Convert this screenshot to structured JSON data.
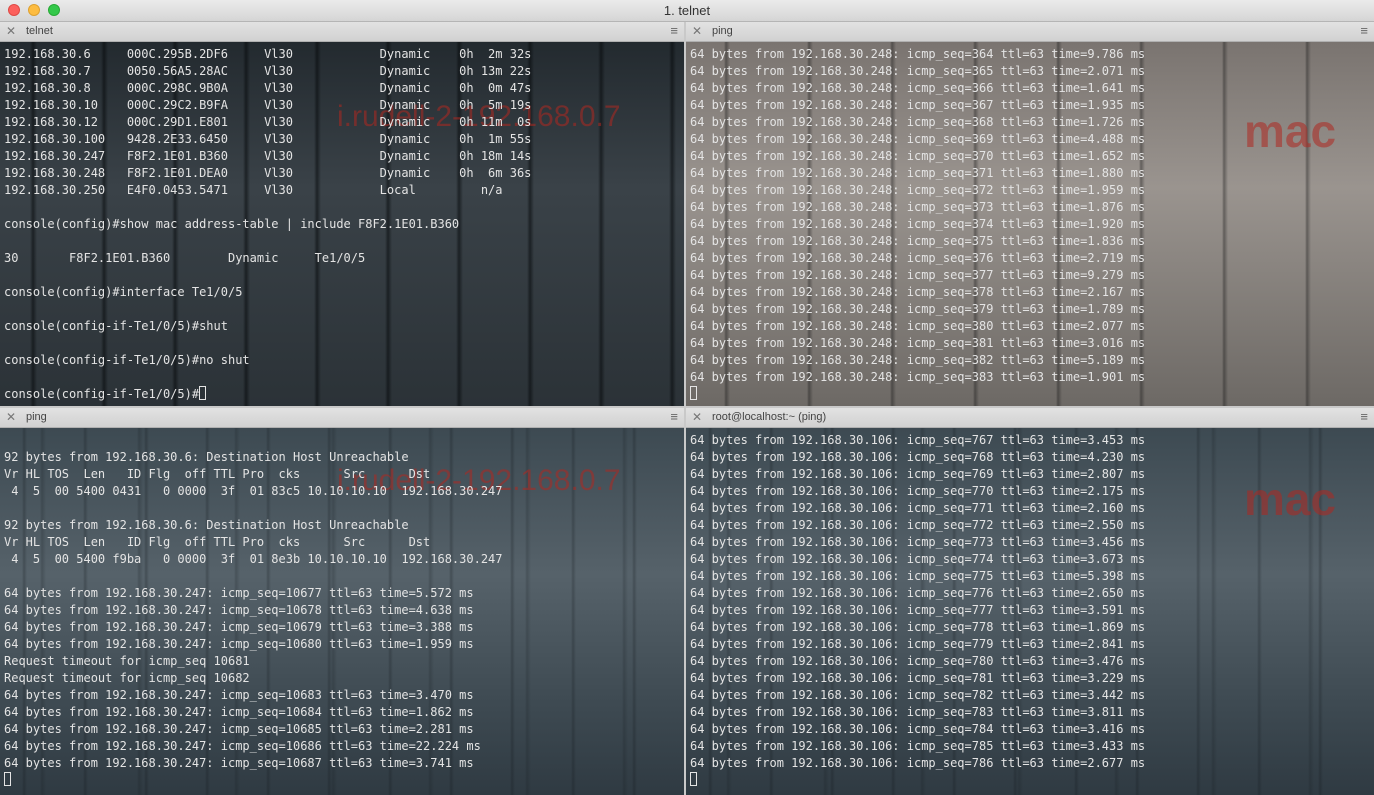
{
  "window": {
    "title": "1. telnet"
  },
  "panes": {
    "top_left": {
      "tab": "telnet",
      "watermark": "i.rudell-2-192.168.0.7",
      "lines": [
        "192.168.30.6     000C.295B.2DF6     Vl30            Dynamic    0h  2m 32s",
        "192.168.30.7     0050.56A5.28AC     Vl30            Dynamic    0h 13m 22s",
        "192.168.30.8     000C.298C.9B0A     Vl30            Dynamic    0h  0m 47s",
        "192.168.30.10    000C.29C2.B9FA     Vl30            Dynamic    0h  5m 19s",
        "192.168.30.12    000C.29D1.E801     Vl30            Dynamic    0h 11m  0s",
        "192.168.30.100   9428.2E33.6450     Vl30            Dynamic    0h  1m 55s",
        "192.168.30.247   F8F2.1E01.B360     Vl30            Dynamic    0h 18m 14s",
        "192.168.30.248   F8F2.1E01.DEA0     Vl30            Dynamic    0h  6m 36s",
        "192.168.30.250   E4F0.0453.5471     Vl30            Local         n/a",
        "",
        "console(config)#show mac address-table | include F8F2.1E01.B360",
        "",
        "30       F8F2.1E01.B360        Dynamic     Te1/0/5",
        "",
        "console(config)#interface Te1/0/5",
        "",
        "console(config-if-Te1/0/5)#shut",
        "",
        "console(config-if-Te1/0/5)#no shut",
        "",
        "console(config-if-Te1/0/5)#"
      ]
    },
    "top_right": {
      "tab": "ping",
      "watermark": "mac",
      "lines": [
        "64 bytes from 192.168.30.248: icmp_seq=364 ttl=63 time=9.786 ms",
        "64 bytes from 192.168.30.248: icmp_seq=365 ttl=63 time=2.071 ms",
        "64 bytes from 192.168.30.248: icmp_seq=366 ttl=63 time=1.641 ms",
        "64 bytes from 192.168.30.248: icmp_seq=367 ttl=63 time=1.935 ms",
        "64 bytes from 192.168.30.248: icmp_seq=368 ttl=63 time=1.726 ms",
        "64 bytes from 192.168.30.248: icmp_seq=369 ttl=63 time=4.488 ms",
        "64 bytes from 192.168.30.248: icmp_seq=370 ttl=63 time=1.652 ms",
        "64 bytes from 192.168.30.248: icmp_seq=371 ttl=63 time=1.880 ms",
        "64 bytes from 192.168.30.248: icmp_seq=372 ttl=63 time=1.959 ms",
        "64 bytes from 192.168.30.248: icmp_seq=373 ttl=63 time=1.876 ms",
        "64 bytes from 192.168.30.248: icmp_seq=374 ttl=63 time=1.920 ms",
        "64 bytes from 192.168.30.248: icmp_seq=375 ttl=63 time=1.836 ms",
        "64 bytes from 192.168.30.248: icmp_seq=376 ttl=63 time=2.719 ms",
        "64 bytes from 192.168.30.248: icmp_seq=377 ttl=63 time=9.279 ms",
        "64 bytes from 192.168.30.248: icmp_seq=378 ttl=63 time=2.167 ms",
        "64 bytes from 192.168.30.248: icmp_seq=379 ttl=63 time=1.789 ms",
        "64 bytes from 192.168.30.248: icmp_seq=380 ttl=63 time=2.077 ms",
        "64 bytes from 192.168.30.248: icmp_seq=381 ttl=63 time=3.016 ms",
        "64 bytes from 192.168.30.248: icmp_seq=382 ttl=63 time=5.189 ms",
        "64 bytes from 192.168.30.248: icmp_seq=383 ttl=63 time=1.901 ms"
      ]
    },
    "bottom_left": {
      "tab": "ping",
      "watermark": "i.rudell-2-192.168.0.7",
      "lines": [
        "",
        "92 bytes from 192.168.30.6: Destination Host Unreachable",
        "Vr HL TOS  Len   ID Flg  off TTL Pro  cks      Src      Dst",
        " 4  5  00 5400 0431   0 0000  3f  01 83c5 10.10.10.10  192.168.30.247",
        "",
        "92 bytes from 192.168.30.6: Destination Host Unreachable",
        "Vr HL TOS  Len   ID Flg  off TTL Pro  cks      Src      Dst",
        " 4  5  00 5400 f9ba   0 0000  3f  01 8e3b 10.10.10.10  192.168.30.247",
        "",
        "64 bytes from 192.168.30.247: icmp_seq=10677 ttl=63 time=5.572 ms",
        "64 bytes from 192.168.30.247: icmp_seq=10678 ttl=63 time=4.638 ms",
        "64 bytes from 192.168.30.247: icmp_seq=10679 ttl=63 time=3.388 ms",
        "64 bytes from 192.168.30.247: icmp_seq=10680 ttl=63 time=1.959 ms",
        "Request timeout for icmp_seq 10681",
        "Request timeout for icmp_seq 10682",
        "64 bytes from 192.168.30.247: icmp_seq=10683 ttl=63 time=3.470 ms",
        "64 bytes from 192.168.30.247: icmp_seq=10684 ttl=63 time=1.862 ms",
        "64 bytes from 192.168.30.247: icmp_seq=10685 ttl=63 time=2.281 ms",
        "64 bytes from 192.168.30.247: icmp_seq=10686 ttl=63 time=22.224 ms",
        "64 bytes from 192.168.30.247: icmp_seq=10687 ttl=63 time=3.741 ms"
      ]
    },
    "bottom_right": {
      "tab": "root@localhost:~ (ping)",
      "watermark": "mac",
      "lines": [
        "64 bytes from 192.168.30.106: icmp_seq=767 ttl=63 time=3.453 ms",
        "64 bytes from 192.168.30.106: icmp_seq=768 ttl=63 time=4.230 ms",
        "64 bytes from 192.168.30.106: icmp_seq=769 ttl=63 time=2.807 ms",
        "64 bytes from 192.168.30.106: icmp_seq=770 ttl=63 time=2.175 ms",
        "64 bytes from 192.168.30.106: icmp_seq=771 ttl=63 time=2.160 ms",
        "64 bytes from 192.168.30.106: icmp_seq=772 ttl=63 time=2.550 ms",
        "64 bytes from 192.168.30.106: icmp_seq=773 ttl=63 time=3.456 ms",
        "64 bytes from 192.168.30.106: icmp_seq=774 ttl=63 time=3.673 ms",
        "64 bytes from 192.168.30.106: icmp_seq=775 ttl=63 time=5.398 ms",
        "64 bytes from 192.168.30.106: icmp_seq=776 ttl=63 time=2.650 ms",
        "64 bytes from 192.168.30.106: icmp_seq=777 ttl=63 time=3.591 ms",
        "64 bytes from 192.168.30.106: icmp_seq=778 ttl=63 time=1.869 ms",
        "64 bytes from 192.168.30.106: icmp_seq=779 ttl=63 time=2.841 ms",
        "64 bytes from 192.168.30.106: icmp_seq=780 ttl=63 time=3.476 ms",
        "64 bytes from 192.168.30.106: icmp_seq=781 ttl=63 time=3.229 ms",
        "64 bytes from 192.168.30.106: icmp_seq=782 ttl=63 time=3.442 ms",
        "64 bytes from 192.168.30.106: icmp_seq=783 ttl=63 time=3.811 ms",
        "64 bytes from 192.168.30.106: icmp_seq=784 ttl=63 time=3.416 ms",
        "64 bytes from 192.168.30.106: icmp_seq=785 ttl=63 time=3.433 ms",
        "64 bytes from 192.168.30.106: icmp_seq=786 ttl=63 time=2.677 ms"
      ]
    }
  }
}
